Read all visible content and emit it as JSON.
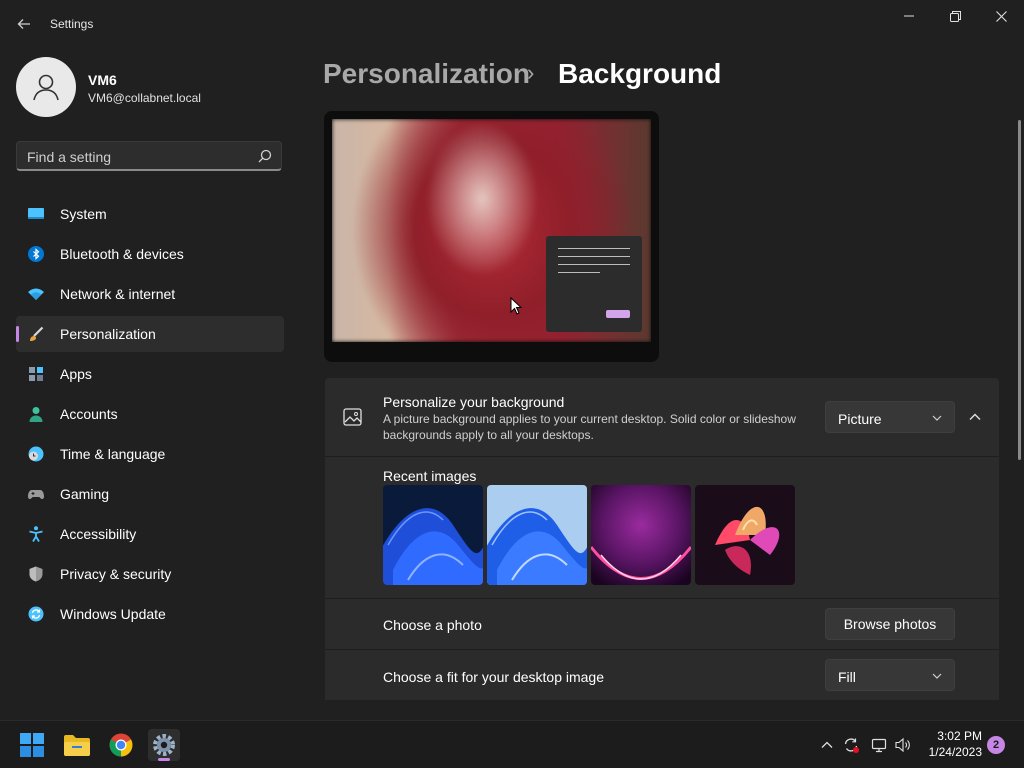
{
  "window": {
    "title": "Settings",
    "controls": {
      "minimize_icon": "minimize-icon",
      "restore_icon": "restore-icon",
      "close_icon": "close-icon"
    }
  },
  "profile": {
    "name": "VM6",
    "email": "VM6@collabnet.local"
  },
  "search": {
    "placeholder": "Find a setting"
  },
  "sidebar": {
    "items": [
      {
        "label": "System",
        "icon": "monitor-icon",
        "color": "#4cc2ff"
      },
      {
        "label": "Bluetooth & devices",
        "icon": "bluetooth-icon",
        "color": "#0078d4"
      },
      {
        "label": "Network & internet",
        "icon": "wifi-icon",
        "color": "#4cc2ff"
      },
      {
        "label": "Personalization",
        "icon": "paintbrush-icon",
        "color": "#e8a33d",
        "selected": true
      },
      {
        "label": "Apps",
        "icon": "apps-icon",
        "color": "#8a9bb0"
      },
      {
        "label": "Accounts",
        "icon": "person-icon",
        "color": "#3fc39e"
      },
      {
        "label": "Time & language",
        "icon": "clock-globe-icon",
        "color": "#4cc2ff"
      },
      {
        "label": "Gaming",
        "icon": "gamepad-icon",
        "color": "#9a9a9a"
      },
      {
        "label": "Accessibility",
        "icon": "accessibility-icon",
        "color": "#4cc2ff"
      },
      {
        "label": "Privacy & security",
        "icon": "shield-icon",
        "color": "#9a9a9a"
      },
      {
        "label": "Windows Update",
        "icon": "update-icon",
        "color": "#4cc2ff"
      }
    ]
  },
  "breadcrumb": {
    "parent": "Personalization",
    "separator": "›",
    "current": "Background"
  },
  "background_card": {
    "title": "Personalize your background",
    "description": "A picture background applies to your current desktop. Solid color or slideshow backgrounds apply to all your desktops.",
    "dropdown_value": "Picture",
    "recent_images_label": "Recent images",
    "recent_images": [
      "bloom-blue-dark",
      "bloom-blue-light",
      "glow-purple",
      "flower-abstract"
    ]
  },
  "choose_photo": {
    "label": "Choose a photo",
    "button": "Browse photos"
  },
  "choose_fit": {
    "label": "Choose a fit for your desktop image",
    "dropdown_value": "Fill"
  },
  "taskbar": {
    "apps": [
      "start-icon",
      "file-explorer-icon",
      "chrome-icon",
      "settings-icon"
    ],
    "time": "3:02 PM",
    "date": "1/24/2023",
    "notification_count": "2"
  },
  "accent_color": "#c686e6"
}
